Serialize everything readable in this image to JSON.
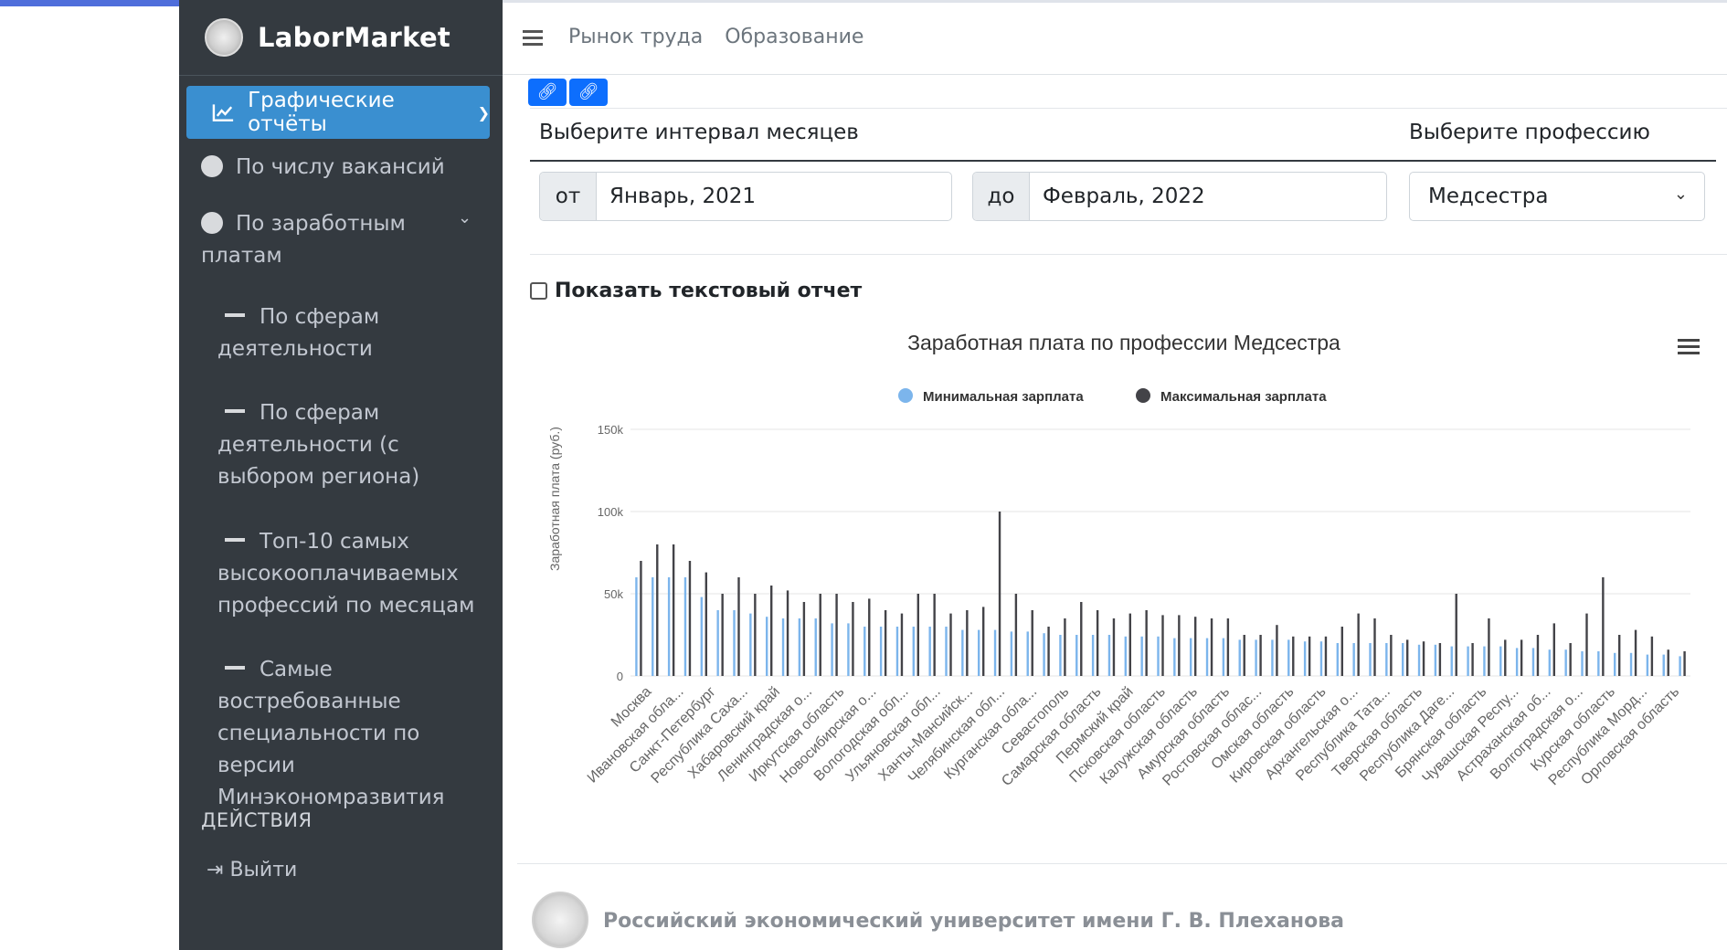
{
  "brand": {
    "name": "LaborMarket"
  },
  "sidebar": {
    "active_item": "Графические отчёты",
    "items": [
      {
        "label": "По числу вакансий"
      },
      {
        "label": "По заработным платам"
      }
    ],
    "sub_items": [
      {
        "label": "По сферам деятельности"
      },
      {
        "label": "По сферам деятельности (с выбором региона)"
      },
      {
        "label": "Топ-10 самых высокооплачиваемых профессий по месяцам"
      },
      {
        "label": "Самые востребованные специальности по версии Минэкономразвития"
      }
    ],
    "section_header": "ДЕЙСТВИЯ",
    "logout_label": "Выйти"
  },
  "topnav": {
    "links": [
      "Рынок труда",
      "Образование"
    ]
  },
  "filters": {
    "interval_label": "Выберите интервал месяцев",
    "profession_label": "Выберите профессию",
    "from_prefix": "от",
    "from_value": "Январь, 2021",
    "to_prefix": "до",
    "to_value": "Февраль, 2022",
    "profession_value": "Медсестра"
  },
  "show_text_report_label": "Показать текстовый отчет",
  "colors": {
    "accent": "#3a8fd0",
    "sidebar_bg": "#343a40",
    "min_series": "#7cb5ec",
    "max_series": "#434348",
    "link_button": "#0d6efd"
  },
  "chart_data": {
    "type": "bar",
    "title": "Заработная плата по профессии Медсестра",
    "ylabel": "Заработная плата (руб.)",
    "xlabel": "",
    "ylim": [
      0,
      150000
    ],
    "yticks": [
      "0",
      "50k",
      "100k",
      "150k"
    ],
    "legend_position": "top-center",
    "grid": true,
    "categories": [
      "Москва",
      "Ивановская обла...",
      "Санкт-Петербург",
      "Республика Саха...",
      "Хабаровский край",
      "Ленинградская о...",
      "Иркутская область",
      "Новосибирская о...",
      "Вологодская обл...",
      "Ульяновская обл...",
      "Ханты-Мансийск...",
      "Челябинская обл...",
      "Курганская обла...",
      "Севастополь",
      "Самарская область",
      "Пермский край",
      "Псковская область",
      "Калужская область",
      "Амурская область",
      "Ростовская облас...",
      "Омская область",
      "Кировская область",
      "Архангельская о...",
      "Республика Тата...",
      "Тверская область",
      "Республика Даге...",
      "Брянская область",
      "Чувашская Респу...",
      "Астраханская об...",
      "Волгоградская о...",
      "Курская область",
      "Республика Морд...",
      "Орловская область"
    ],
    "series": [
      {
        "name": "Минимальная зарплата",
        "values": [
          60000,
          60000,
          60000,
          60000,
          48000,
          40000,
          40000,
          38000,
          36000,
          35000,
          35000,
          35000,
          32000,
          32000,
          30000,
          30000,
          30000,
          30000,
          30000,
          30000,
          28000,
          28000,
          28000,
          27000,
          27000,
          26000,
          25000,
          25000,
          25000,
          25000,
          24000,
          24000,
          24000,
          23000,
          23000,
          23000,
          23000,
          22000,
          22000,
          22000,
          22000,
          21000,
          21000,
          20000,
          20000,
          20000,
          20000,
          20000,
          19000,
          19000,
          18000,
          18000,
          18000,
          18000,
          17000,
          17000,
          16000,
          16000,
          15000,
          15000,
          14000,
          14000,
          13000,
          13000,
          12000
        ]
      },
      {
        "name": "Максимальная зарплата",
        "values": [
          70000,
          80000,
          80000,
          70000,
          63000,
          50000,
          60000,
          50000,
          55000,
          52000,
          45000,
          50000,
          50000,
          45000,
          47000,
          40000,
          38000,
          50000,
          50000,
          38000,
          40000,
          42000,
          100000,
          50000,
          40000,
          30000,
          35000,
          45000,
          40000,
          35000,
          38000,
          40000,
          37000,
          37000,
          36000,
          35000,
          35000,
          25000,
          25000,
          31000,
          24000,
          24000,
          24000,
          30000,
          38000,
          35000,
          25000,
          22000,
          21000,
          20000,
          50000,
          20000,
          35000,
          22000,
          22000,
          25000,
          32000,
          20000,
          38000,
          60000,
          25000,
          28000,
          24000,
          16000,
          15000
        ]
      }
    ]
  },
  "footer": {
    "text": "Российский экономический университет имени Г. В. Плеханова"
  }
}
